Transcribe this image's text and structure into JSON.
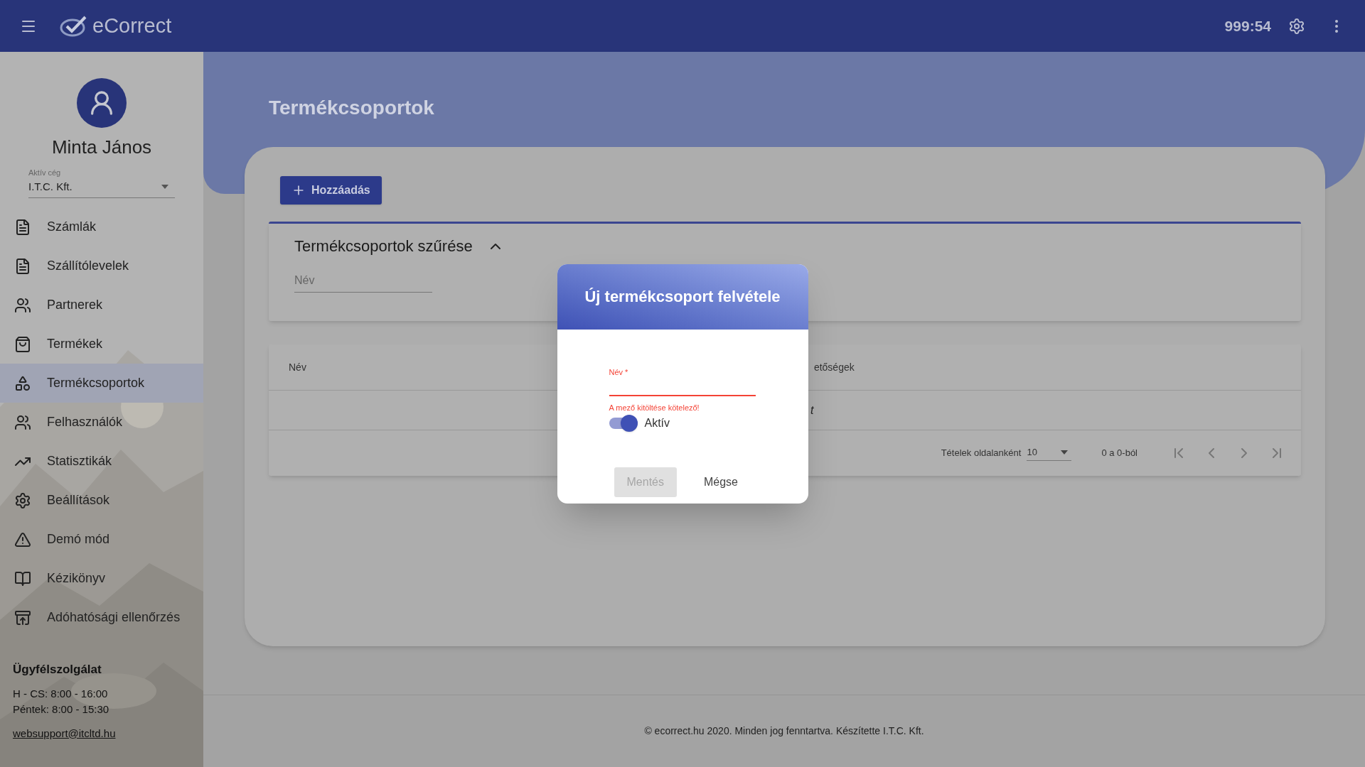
{
  "app_bar": {
    "app_name": "eCorrect",
    "timer": "999:54"
  },
  "sidebar": {
    "user_name": "Minta János",
    "company_select": {
      "label": "Aktív cég",
      "value": "I.T.C. Kft."
    },
    "items": [
      {
        "label": "Számlák",
        "selected": false
      },
      {
        "label": "Szállítólevelek",
        "selected": false
      },
      {
        "label": "Partnerek",
        "selected": false
      },
      {
        "label": "Termékek",
        "selected": false
      },
      {
        "label": "Termékcsoportok",
        "selected": true
      },
      {
        "label": "Felhasználók",
        "selected": false
      },
      {
        "label": "Statisztikák",
        "selected": false
      },
      {
        "label": "Beállítások",
        "selected": false
      },
      {
        "label": "Demó mód",
        "selected": false
      },
      {
        "label": "Kézikönyv",
        "selected": false
      },
      {
        "label": "Adóhatósági ellenőrzés",
        "selected": false
      }
    ],
    "support": {
      "title": "Ügyfélszolgálat",
      "hours": [
        "H - CS: 8:00 - 16:00",
        "Péntek: 8:00 - 15:30"
      ],
      "email": "websupport@itcltd.hu"
    }
  },
  "page": {
    "title": "Termékcsoportok",
    "add_button": "Hozzáadás",
    "filter": {
      "title": "Termékcsoportok szűrése",
      "expanded": true,
      "name_field": {
        "placeholder": "Név"
      }
    },
    "table": {
      "columns": [
        "Név",
        "etőségek"
      ],
      "rows": [
        [
          "",
          "t"
        ]
      ],
      "pagination": {
        "rows_per_page_label": "Tételek oldalanként",
        "rows_per_page": "10",
        "range": "0 a 0-ból"
      }
    }
  },
  "dialog": {
    "title": "Új termékcsoport felvétele",
    "name_field": {
      "label": "Név *",
      "invalid": true,
      "error": "A mező kitöltése kötelező!"
    },
    "active_switch": {
      "label": "Aktív",
      "on": true
    },
    "buttons": [
      {
        "label": "Mentés",
        "disabled": true
      },
      {
        "label": "Mégse",
        "disabled": false
      }
    ]
  },
  "footer": "© ecorrect.hu 2020. Minden jog fenntartva. Készítette I.T.C. Kft."
}
